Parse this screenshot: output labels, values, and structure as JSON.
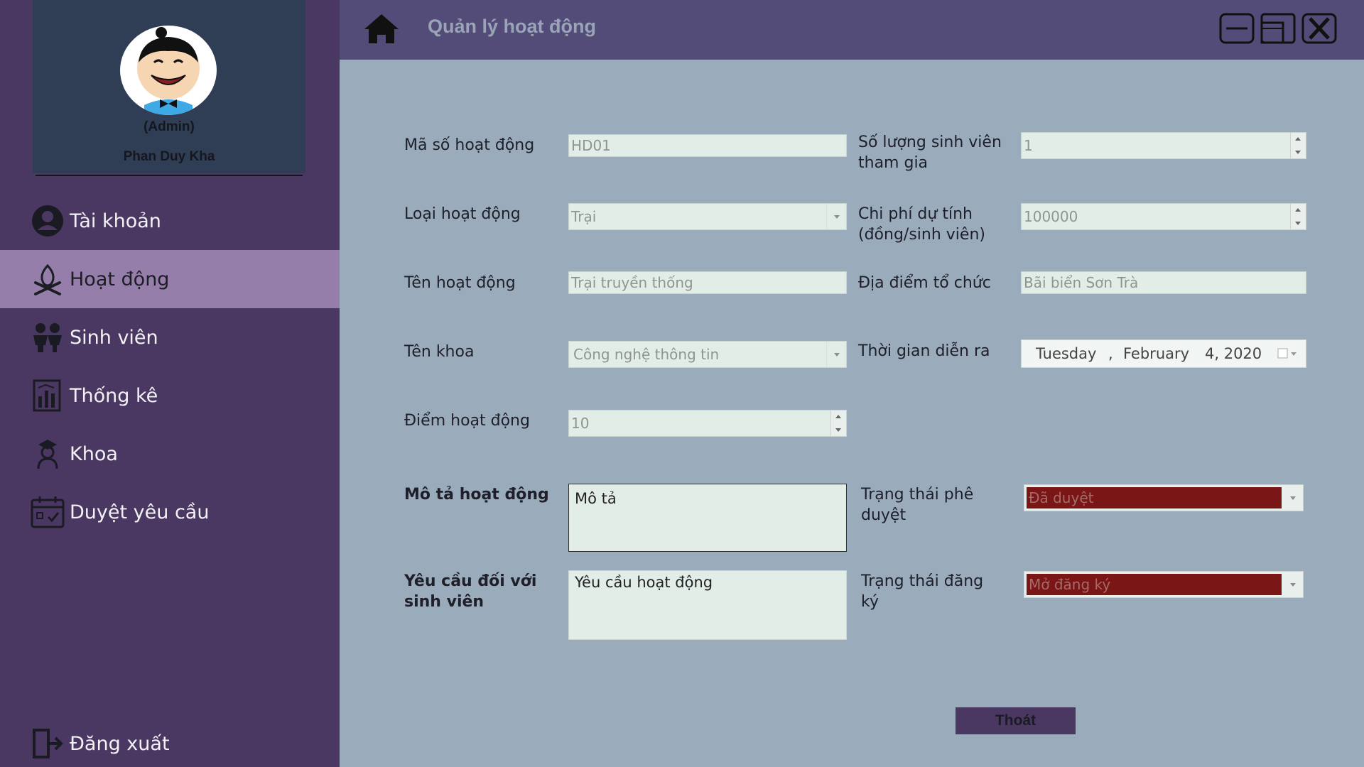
{
  "profile": {
    "role": "(Admin)",
    "name": "Phan Duy Kha"
  },
  "sidebar": {
    "items": [
      {
        "label": "Tài khoản",
        "icon": "user-circle-icon",
        "active": false
      },
      {
        "label": "Hoạt động",
        "icon": "campfire-icon",
        "active": true
      },
      {
        "label": "Sinh viên",
        "icon": "students-icon",
        "active": false
      },
      {
        "label": "Thống kê",
        "icon": "statistics-icon",
        "active": false
      },
      {
        "label": "Khoa",
        "icon": "graduate-icon",
        "active": false
      },
      {
        "label": "Duyệt yêu cầu",
        "icon": "calendar-check-icon",
        "active": false
      }
    ],
    "logout": {
      "label": "Đăng xuất",
      "icon": "logout-icon"
    }
  },
  "header": {
    "title": "Quản lý hoạt động"
  },
  "form": {
    "ma_so": {
      "label": "Mã số hoạt động",
      "value": "HD01"
    },
    "loai": {
      "label": "Loại hoạt động",
      "value": "Trại"
    },
    "ten": {
      "label": "Tên hoạt động",
      "value": "Trại truyền thống"
    },
    "khoa": {
      "label": "Tên khoa",
      "value": "Công nghệ thông tin"
    },
    "diem": {
      "label": "Điểm hoạt động",
      "value": "10"
    },
    "so_luong": {
      "label_line1": "Số lượng sinh viên",
      "label_line2": "tham gia",
      "value": "1"
    },
    "chi_phi": {
      "label_line1": "Chi phí dự tính",
      "label_line2": "(đồng/sinh viên)",
      "value": "100000"
    },
    "dia_diem": {
      "label": "Địa điểm tổ chức",
      "value": "Bãi biển Sơn Trà"
    },
    "thoi_gian": {
      "label": "Thời gian diễn ra",
      "weekday": "Tuesday",
      "sep": ",",
      "month": "February",
      "day_year": "4, 2020"
    },
    "mo_ta": {
      "label": "Mô tả hoạt động",
      "value": "Mô tả"
    },
    "yeu_cau": {
      "label_line1": "Yêu cầu đối với",
      "label_line2": "sinh viên",
      "value": "Yêu cầu hoạt động"
    },
    "trang_thai_duyet": {
      "label_line1": "Trạng thái phê",
      "label_line2": "duyệt",
      "value": "Đã duyệt"
    },
    "trang_thai_dang_ky": {
      "label_line1": "Trạng thái đăng",
      "label_line2": "ký",
      "value": "Mở đăng ký"
    }
  },
  "buttons": {
    "exit": "Thoát"
  },
  "colors": {
    "sidebar": "#4b3862",
    "header": "#544c78",
    "content": "#9aabbc",
    "active_item": "#957eaa",
    "status_red": "#7a1616"
  }
}
